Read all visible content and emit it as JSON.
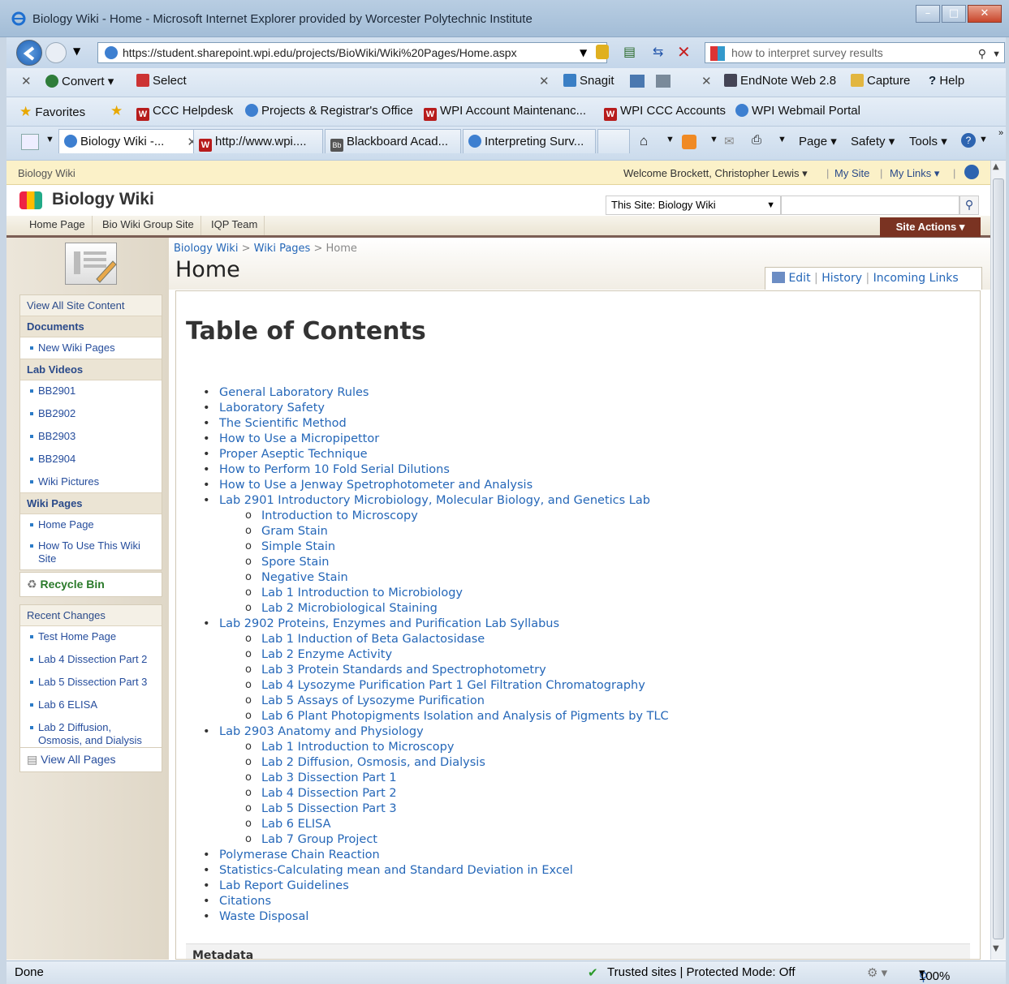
{
  "browser": {
    "window_title": "Biology Wiki - Home - Microsoft Internet Explorer provided by Worcester Polytechnic Institute",
    "url": "https://student.sharepoint.wpi.edu/projects/BioWiki/Wiki%20Pages/Home.aspx",
    "search_text": "how to interpret survey results",
    "toolbar1": {
      "convert": "Convert",
      "select": "Select",
      "snagit": "Snagit",
      "endnote": "EndNote Web 2.8",
      "capture": "Capture",
      "help": "Help"
    },
    "favorites_label": "Favorites",
    "favorites": [
      "CCC Helpdesk",
      "Projects & Registrar's Office",
      "WPI Account Maintenanc...",
      "WPI CCC Accounts",
      "WPI Webmail Portal"
    ],
    "tabs": [
      "Biology Wiki -...",
      "http://www.wpi....",
      "Blackboard Acad...",
      "Interpreting Surv..."
    ],
    "cmd": {
      "page": "Page",
      "safety": "Safety",
      "tools": "Tools"
    },
    "status": {
      "left": "Done",
      "zone": "Trusted sites | Protected Mode: Off",
      "zoom": "100%"
    }
  },
  "site": {
    "band_title": "Biology Wiki",
    "welcome": "Welcome Brockett, Christopher Lewis",
    "my_site": "My Site",
    "my_links": "My Links",
    "name": "Biology Wiki",
    "scope": "This Site: Biology Wiki",
    "nav": [
      "Home Page",
      "Bio Wiki Group Site",
      "IQP Team"
    ],
    "site_actions": "Site Actions",
    "breadcrumb": [
      "Biology Wiki",
      "Wiki Pages",
      "Home"
    ],
    "page_title": "Home",
    "actions": {
      "edit": "Edit",
      "history": "History",
      "incoming": "Incoming Links"
    }
  },
  "quicklaunch": {
    "view_all": "View All Site Content",
    "documents": "Documents",
    "documents_items": [
      "New Wiki Pages"
    ],
    "lab_videos": "Lab Videos",
    "lab_videos_items": [
      "BB2901",
      "BB2902",
      "BB2903",
      "BB2904",
      "Wiki Pictures"
    ],
    "wiki_pages": "Wiki Pages",
    "wiki_pages_items": [
      "Home Page",
      "How To Use This Wiki Site"
    ],
    "recycle": "Recycle Bin",
    "recent": "Recent Changes",
    "recent_items": [
      "Test Home Page",
      "Lab 4 Dissection Part 2",
      "Lab 5 Dissection Part 3",
      "Lab 6 ELISA",
      "Lab 2 Diffusion, Osmosis, and Dialysis"
    ],
    "view_all_pages": "View All Pages"
  },
  "toc": {
    "heading": "Table of Contents",
    "items": [
      {
        "level": 1,
        "text": "General Laboratory Rules"
      },
      {
        "level": 1,
        "text": "Laboratory Safety"
      },
      {
        "level": 1,
        "text": "The Scientific Method"
      },
      {
        "level": 1,
        "text": "How to Use a Micropipettor"
      },
      {
        "level": 1,
        "text": "Proper Aseptic Technique"
      },
      {
        "level": 1,
        "text": "How to Perform 10 Fold Serial Dilutions"
      },
      {
        "level": 1,
        "text": "How to Use a Jenway Spetrophotometer and Analysis"
      },
      {
        "level": 1,
        "text": "Lab 2901 Introductory Microbiology, Molecular Biology, and Genetics Lab"
      },
      {
        "level": 2,
        "text": "Introduction to Microscopy"
      },
      {
        "level": 2,
        "text": "Gram Stain"
      },
      {
        "level": 2,
        "text": "Simple Stain"
      },
      {
        "level": 2,
        "text": "Spore Stain"
      },
      {
        "level": 2,
        "text": "Negative Stain"
      },
      {
        "level": 2,
        "text": "Lab 1 Introduction to Microbiology"
      },
      {
        "level": 2,
        "text": "Lab 2 Microbiological Staining"
      },
      {
        "level": 1,
        "text": "Lab 2902 Proteins, Enzymes and Purification Lab Syllabus"
      },
      {
        "level": 2,
        "text": "Lab 1 Induction of Beta Galactosidase"
      },
      {
        "level": 2,
        "text": "Lab 2 Enzyme Activity"
      },
      {
        "level": 2,
        "text": "Lab 3 Protein Standards and Spectrophotometry"
      },
      {
        "level": 2,
        "text": "Lab 4 Lysozyme Purification Part 1 Gel Filtration Chromatography"
      },
      {
        "level": 2,
        "text": "Lab 5 Assays of Lysozyme Purification"
      },
      {
        "level": 2,
        "text": "Lab 6 Plant Photopigments Isolation and Analysis of Pigments by TLC"
      },
      {
        "level": 1,
        "text": "Lab 2903 Anatomy and Physiology"
      },
      {
        "level": 2,
        "text": "Lab 1 Introduction to Microscopy"
      },
      {
        "level": 2,
        "text": "Lab 2 Diffusion, Osmosis, and Dialysis"
      },
      {
        "level": 2,
        "text": "Lab 3 Dissection Part 1"
      },
      {
        "level": 2,
        "text": "Lab 4 Dissection Part 2"
      },
      {
        "level": 2,
        "text": "Lab 5 Dissection Part 3"
      },
      {
        "level": 2,
        "text": "Lab 6 ELISA"
      },
      {
        "level": 2,
        "text": "Lab 7 Group Project"
      },
      {
        "level": 1,
        "text": "Polymerase Chain Reaction"
      },
      {
        "level": 1,
        "text": "Statistics-Calculating mean and Standard Deviation in Excel"
      },
      {
        "level": 1,
        "text": "Lab Report Guidelines"
      },
      {
        "level": 1,
        "text": "Citations"
      },
      {
        "level": 1,
        "text": "Waste Disposal"
      }
    ],
    "metadata_label": "Metadata"
  }
}
